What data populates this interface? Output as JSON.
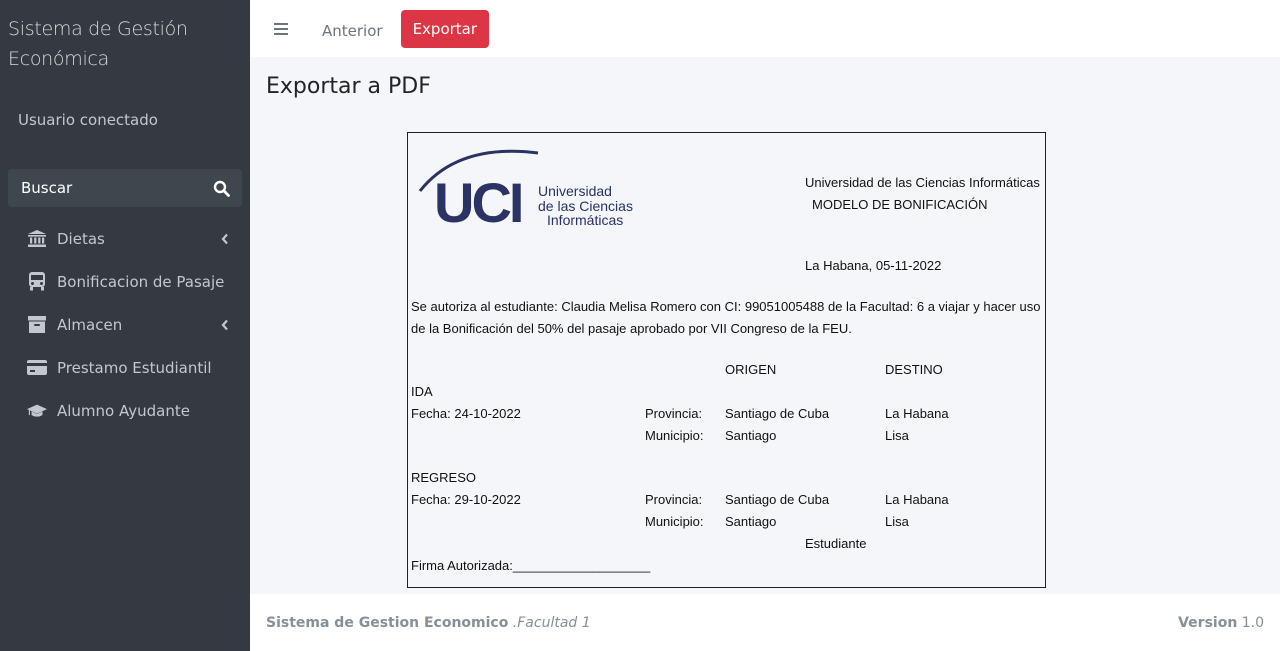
{
  "sidebar": {
    "brand_line1": "Sistema de Gestión",
    "brand_line2": "Económica",
    "user": "Usuario conectado",
    "search_label": "Buscar",
    "items": [
      {
        "label": "Dietas",
        "icon": "bank-icon",
        "has_children": true
      },
      {
        "label": "Bonificacion de Pasaje",
        "icon": "bus-icon",
        "has_children": false
      },
      {
        "label": "Almacen",
        "icon": "archive-icon",
        "has_children": true
      },
      {
        "label": "Prestamo Estudiantil",
        "icon": "credit-card-icon",
        "has_children": false
      },
      {
        "label": "Alumno Ayudante",
        "icon": "graduation-cap-icon",
        "has_children": false
      }
    ]
  },
  "topbar": {
    "prev_label": "Anterior",
    "export_label": "Exportar",
    "export_color": "#dc3545"
  },
  "page": {
    "title": "Exportar a PDF"
  },
  "document": {
    "logo_letters": "UCI",
    "logo_text_1": "Universidad",
    "logo_text_2": "de las Ciencias",
    "logo_text_3": "Informáticas",
    "institution": "Universidad de las Ciencias Informáticas",
    "model": "MODELO DE BONIFICACIÓN",
    "place_date": "La Habana, 05-11-2022",
    "body_line1": "Se autoriza al estudiante: Claudia Melisa Romero con CI: 99051005488 de la Facultad: 6 a viajar y hacer uso",
    "body_line2": "de la Bonificación del 50% del pasaje aprobado por VII Congreso de la FEU.",
    "col_origin": "ORIGEN",
    "col_destination": "DESTINO",
    "ida_label": "IDA",
    "ida_date": "Fecha: 24-10-2022",
    "ida_provincia_label": "Provincia:",
    "ida_provincia_origen": "Santiago de Cuba",
    "ida_provincia_destino": "La Habana",
    "ida_municipio_label": "Municipio:",
    "ida_municipio_origen": "Santiago",
    "ida_municipio_destino": "Lisa",
    "regreso_label": "REGRESO",
    "regreso_date": "Fecha: 29-10-2022",
    "regreso_provincia_label": "Provincia:",
    "regreso_provincia_origen": "Santiago de Cuba",
    "regreso_provincia_destino": "La Habana",
    "regreso_municipio_label": "Municipio:",
    "regreso_municipio_origen": "Santiago",
    "regreso_municipio_destino": "Lisa",
    "student_label": "Estudiante",
    "signature_label": "Firma Autorizada:___________________"
  },
  "footer": {
    "app_name": "Sistema de Gestion Economico",
    "faculty": ".Facultad 1",
    "version_label": "Version",
    "version_number": "1.0"
  }
}
